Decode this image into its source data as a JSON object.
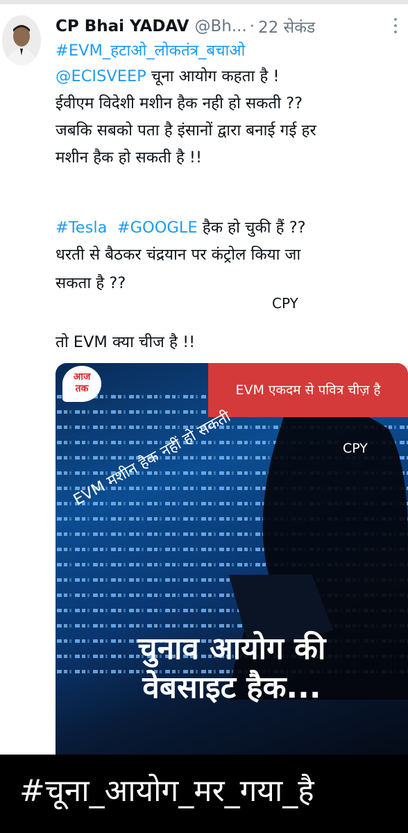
{
  "tweet": {
    "author_name": "CP Bhai YADAV",
    "handle": "@Bh...",
    "separator": "·",
    "time": "22 सेकंड",
    "more_icon": "more-vertical-icon",
    "avatar_icon": "user-avatar",
    "line1_hashtag": "#EVM_हटाओ_लोकतंत्र_बचाओ",
    "line2_mention": "@ECISVEEP",
    "line2_text": " चूना आयोग कहता है !",
    "line3": "ईवीएम विदेशी मशीन हैक नही हो सकती ??",
    "line4": "जबकि सबको पता है इंसानों द्वारा बनाई गई हर",
    "line5": "मशीन हैक हो सकती है !!",
    "line6_tag1": "#Tesla",
    "line6_tag2": "#GOOGLE",
    "line6_text": " हैक हो चुकी हैं  ??",
    "line7": "धरती से बैठकर चंद्रयान पर कंट्रोल किया जा",
    "line8": "सकता है ??",
    "cpy": "CPY",
    "line9": "तो EVM क्या चीज है !!"
  },
  "media": {
    "logo_text": "आज तक",
    "banner": "EVM एकदम से पवित्र चीज़ है",
    "overlay": "EVM मशीन हैक नहीं हो सकती",
    "cpy": "CPY",
    "headline_line1": "चुनाव आयोग की",
    "headline_line2": "वेबसाइट हैक...",
    "colors": {
      "banner": "#d43a3a",
      "background": "#0c4d92"
    }
  },
  "footer": {
    "text": "#चूना_आयोग_मर_गया_है"
  },
  "colors": {
    "link": "#1d9bf0",
    "muted": "#6a7580"
  }
}
